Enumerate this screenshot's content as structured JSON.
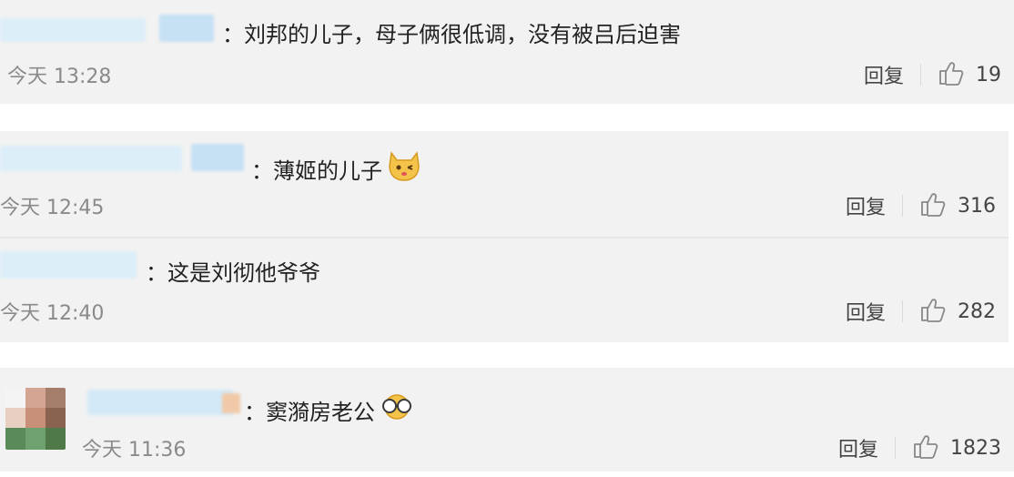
{
  "comments": [
    {
      "text": "：刘邦的儿子，母子俩很低调，没有被吕后迫害",
      "time": "今天 13:28",
      "reply": "回复",
      "likes": "19"
    },
    {
      "text": "：薄姬的儿子",
      "time": "今天 12:45",
      "reply": "回复",
      "likes": "316",
      "emoji": "cat-face-icon"
    },
    {
      "text": "：这是刘彻他爷爷",
      "time": "今天 12:40",
      "reply": "回复",
      "likes": "282"
    },
    {
      "text": "：窦漪房老公",
      "time": "今天 11:36",
      "reply": "回复",
      "likes": "1823",
      "emoji": "glasses-face-icon"
    }
  ],
  "colors": {
    "card_bg": "#f2f2f2",
    "blur_blue": "#cfe6f6",
    "time_gray": "#8a8a8a"
  }
}
